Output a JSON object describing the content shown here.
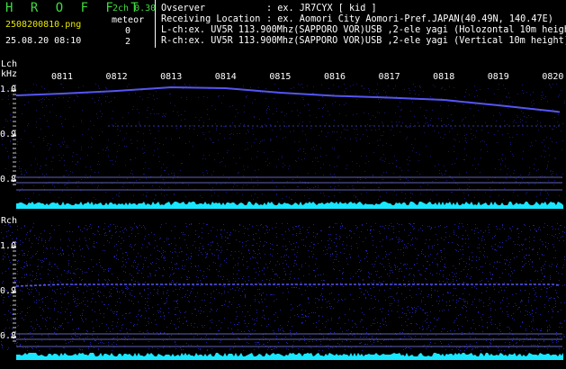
{
  "header": {
    "title": "H R O F F T",
    "mode": "2ch 0.30",
    "filename": "2508200810.png",
    "timestamp": "25.08.20 08:10",
    "meteor_label": "meteor",
    "lch_count": "0",
    "rch_count": "2",
    "observer_key": "Ovserver",
    "observer_val": ": ex. JR7CYX [ kid ]",
    "location_key": "Receiving Location",
    "location_val": ": ex. Aomori City Aomori-Pref.JAPAN(40.49N, 140.47E)",
    "lch_info": "L-ch:ex. UV5R 113.900Mhz(SAPPORO VOR)USB ,2-ele yagi (Holozontal 10m height)",
    "rch_info": "R-ch:ex. UV5R 113.900Mhz(SAPPORO VOR)USB ,2-ele yagi (Vertical 10m height)"
  },
  "lch": {
    "label": "Lch",
    "unit": "kHz"
  },
  "rch": {
    "label": "Rch"
  },
  "time_ticks": [
    "0811",
    "0812",
    "0813",
    "0814",
    "0815",
    "0816",
    "0817",
    "0818",
    "0819",
    "0820"
  ],
  "y_ticks": [
    "1.0",
    "0.9",
    "0.8"
  ],
  "colors": {
    "bg": "#000000",
    "noise": "#2a2ad8",
    "signal": "#5a5aff",
    "floor": "#19e6ff",
    "green": "#3fdc3f",
    "yellow": "#e8e800"
  },
  "chart_data": {
    "type": "heatmap",
    "x": [
      "0811",
      "0812",
      "0813",
      "0814",
      "0815",
      "0816",
      "0817",
      "0818",
      "0819",
      "0820"
    ],
    "ylabel": "kHz",
    "ylim": [
      0.78,
      1.02
    ],
    "series": [
      {
        "name": "Lch",
        "x": [
          "0811",
          "0812",
          "0813",
          "0814",
          "0815",
          "0816",
          "0817",
          "0818",
          "0819",
          "0820"
        ],
        "values": [
          0.994,
          1.0,
          1.008,
          1.006,
          0.996,
          0.989,
          0.985,
          0.98,
          0.968,
          0.955
        ]
      },
      {
        "name": "Rch",
        "x": [
          "0811",
          "0812",
          "0813",
          "0814",
          "0815",
          "0816",
          "0817",
          "0818",
          "0819",
          "0820"
        ],
        "values": [
          0.918,
          0.918,
          0.918,
          0.918,
          0.918,
          0.918,
          0.918,
          0.918,
          0.918,
          0.918
        ]
      }
    ]
  }
}
